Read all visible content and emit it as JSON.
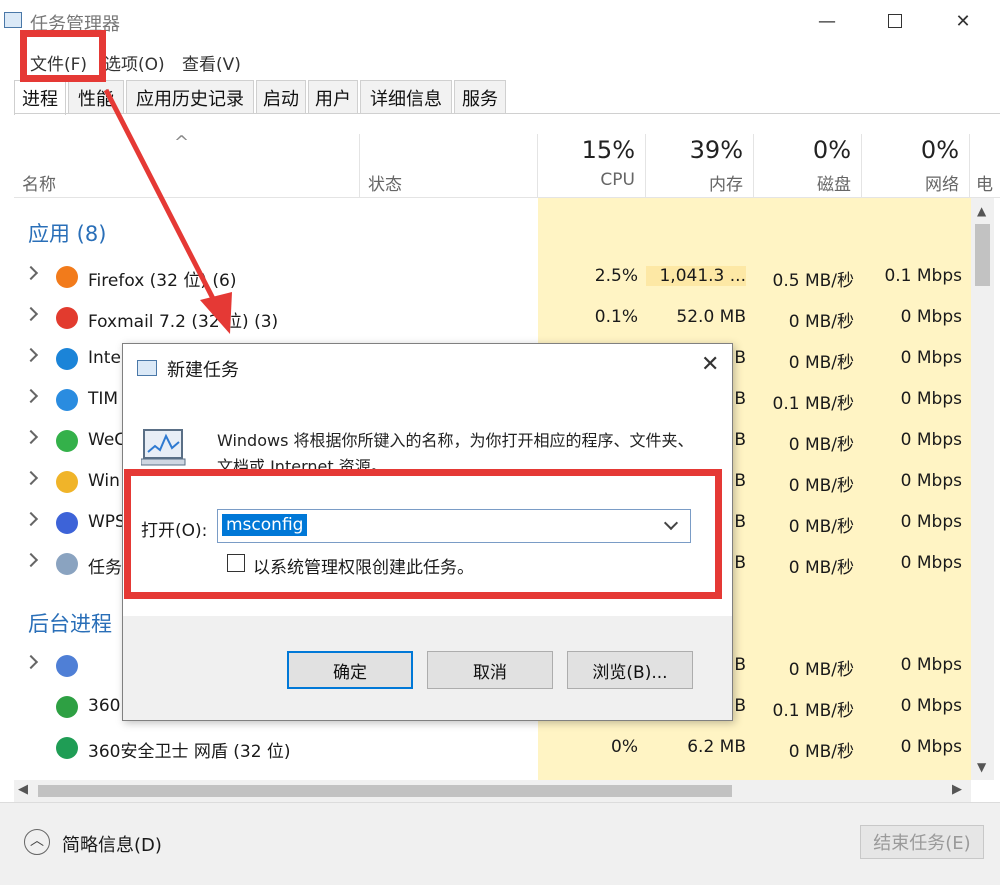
{
  "window": {
    "title": "任务管理器"
  },
  "menu": {
    "file": "文件(F)",
    "options": "选项(O)",
    "view": "查看(V)"
  },
  "tabs": [
    "进程",
    "性能",
    "应用历史记录",
    "启动",
    "用户",
    "详细信息",
    "服务"
  ],
  "header": {
    "name": "名称",
    "status": "状态",
    "cpu_pct": "15%",
    "cpu": "CPU",
    "mem_pct": "39%",
    "mem": "内存",
    "disk_pct": "0%",
    "disk": "磁盘",
    "net_pct": "0%",
    "net": "网络",
    "extra": "电"
  },
  "groups": {
    "apps": "应用 (8)",
    "background": "后台进程"
  },
  "rows": [
    {
      "name": "Firefox (32 位) (6)",
      "cpu": "2.5%",
      "mem": "1,041.3 ...",
      "disk": "0.5 MB/秒",
      "net": "0.1 Mbps",
      "icon": "firefox-icon"
    },
    {
      "name": "Foxmail 7.2 (32 位) (3)",
      "cpu": "0.1%",
      "mem": "52.0 MB",
      "disk": "0 MB/秒",
      "net": "0 Mbps",
      "icon": "foxmail-icon"
    },
    {
      "name": "Inte",
      "cpu": "",
      "mem": "B",
      "disk": "0 MB/秒",
      "net": "0 Mbps",
      "icon": "ie-icon"
    },
    {
      "name": "TIM",
      "cpu": "",
      "mem": "B",
      "disk": "0.1 MB/秒",
      "net": "0 Mbps",
      "icon": "tim-icon"
    },
    {
      "name": "WeC",
      "cpu": "",
      "mem": "B",
      "disk": "0 MB/秒",
      "net": "0 Mbps",
      "icon": "wechat-icon"
    },
    {
      "name": "Win",
      "cpu": "",
      "mem": "B",
      "disk": "0 MB/秒",
      "net": "0 Mbps",
      "icon": "folder-icon"
    },
    {
      "name": "WPS",
      "cpu": "",
      "mem": "B",
      "disk": "0 MB/秒",
      "net": "0 Mbps",
      "icon": "wps-icon"
    },
    {
      "name": "任务",
      "cpu": "",
      "mem": "B",
      "disk": "0 MB/秒",
      "net": "0 Mbps",
      "icon": "taskmgr-icon"
    },
    {
      "name": "",
      "cpu": "",
      "mem": "B",
      "disk": "0 MB/秒",
      "net": "0 Mbps",
      "icon": "gear-icon"
    },
    {
      "name": "360",
      "cpu": "",
      "mem": "B",
      "disk": "0.1 MB/秒",
      "net": "0 Mbps",
      "icon": "360-icon"
    },
    {
      "name": "360安全卫士 网盾 (32 位)",
      "cpu": "0%",
      "mem": "6.2 MB",
      "disk": "0 MB/秒",
      "net": "0 Mbps",
      "icon": "shield-icon"
    }
  ],
  "bottom": {
    "summary": "简略信息(D)",
    "end_task": "结束任务(E)"
  },
  "dialog": {
    "title": "新建任务",
    "description": "Windows 将根据你所键入的名称，为你打开相应的程序、文件夹、文档或 Internet 资源。",
    "open_label": "打开(O):",
    "input_value": "msconfig",
    "admin_checkbox": "以系统管理权限创建此任务。",
    "ok": "确定",
    "cancel": "取消",
    "browse": "浏览(B)..."
  },
  "colors": {
    "annotation": "#e53935",
    "hot_cell": "#fff4c4",
    "hot_cell_strong": "#fde8a5",
    "accent": "#0078d7"
  }
}
